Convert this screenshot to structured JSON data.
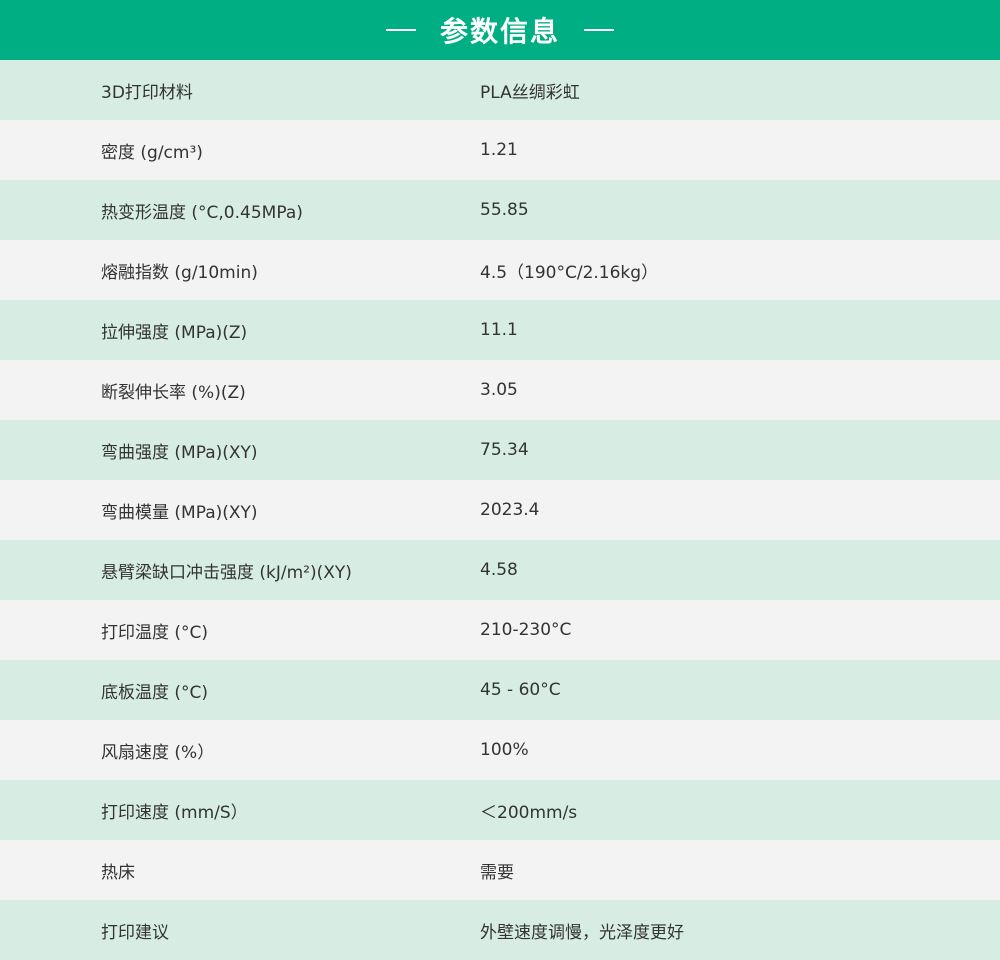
{
  "header": {
    "title": "参数信息"
  },
  "colors": {
    "header_bg": "#00ae84",
    "row_tint": "#d7ede4",
    "row_plain": "#f3f3f3",
    "text": "#333333"
  },
  "rows": [
    {
      "name": "3D打印材料",
      "value": "PLA丝绸彩虹"
    },
    {
      "name": "密度 (g/cm³)",
      "value": "1.21"
    },
    {
      "name": "热变形温度 (°C,0.45MPa)",
      "value": "55.85"
    },
    {
      "name": "熔融指数 (g/10min)",
      "value": "4.5（190°C/2.16kg）"
    },
    {
      "name": "拉伸强度 (MPa)(Z)",
      "value": "11.1"
    },
    {
      "name": "断裂伸长率 (%)(Z)",
      "value": "3.05"
    },
    {
      "name": "弯曲强度 (MPa)(XY)",
      "value": "75.34"
    },
    {
      "name": "弯曲模量 (MPa)(XY)",
      "value": "2023.4"
    },
    {
      "name": "悬臂梁缺口冲击强度 (kJ/m²)(XY)",
      "value": "4.58"
    },
    {
      "name": "打印温度 (°C)",
      "value": "210-230°C"
    },
    {
      "name": "底板温度 (°C)",
      "value": "45 - 60°C"
    },
    {
      "name": "风扇速度 (%）",
      "value": "100%"
    },
    {
      "name": "打印速度 (mm/S）",
      "value": "＜200mm/s"
    },
    {
      "name": "热床",
      "value": "需要"
    },
    {
      "name": "打印建议",
      "value": "外壁速度调慢，光泽度更好"
    }
  ]
}
